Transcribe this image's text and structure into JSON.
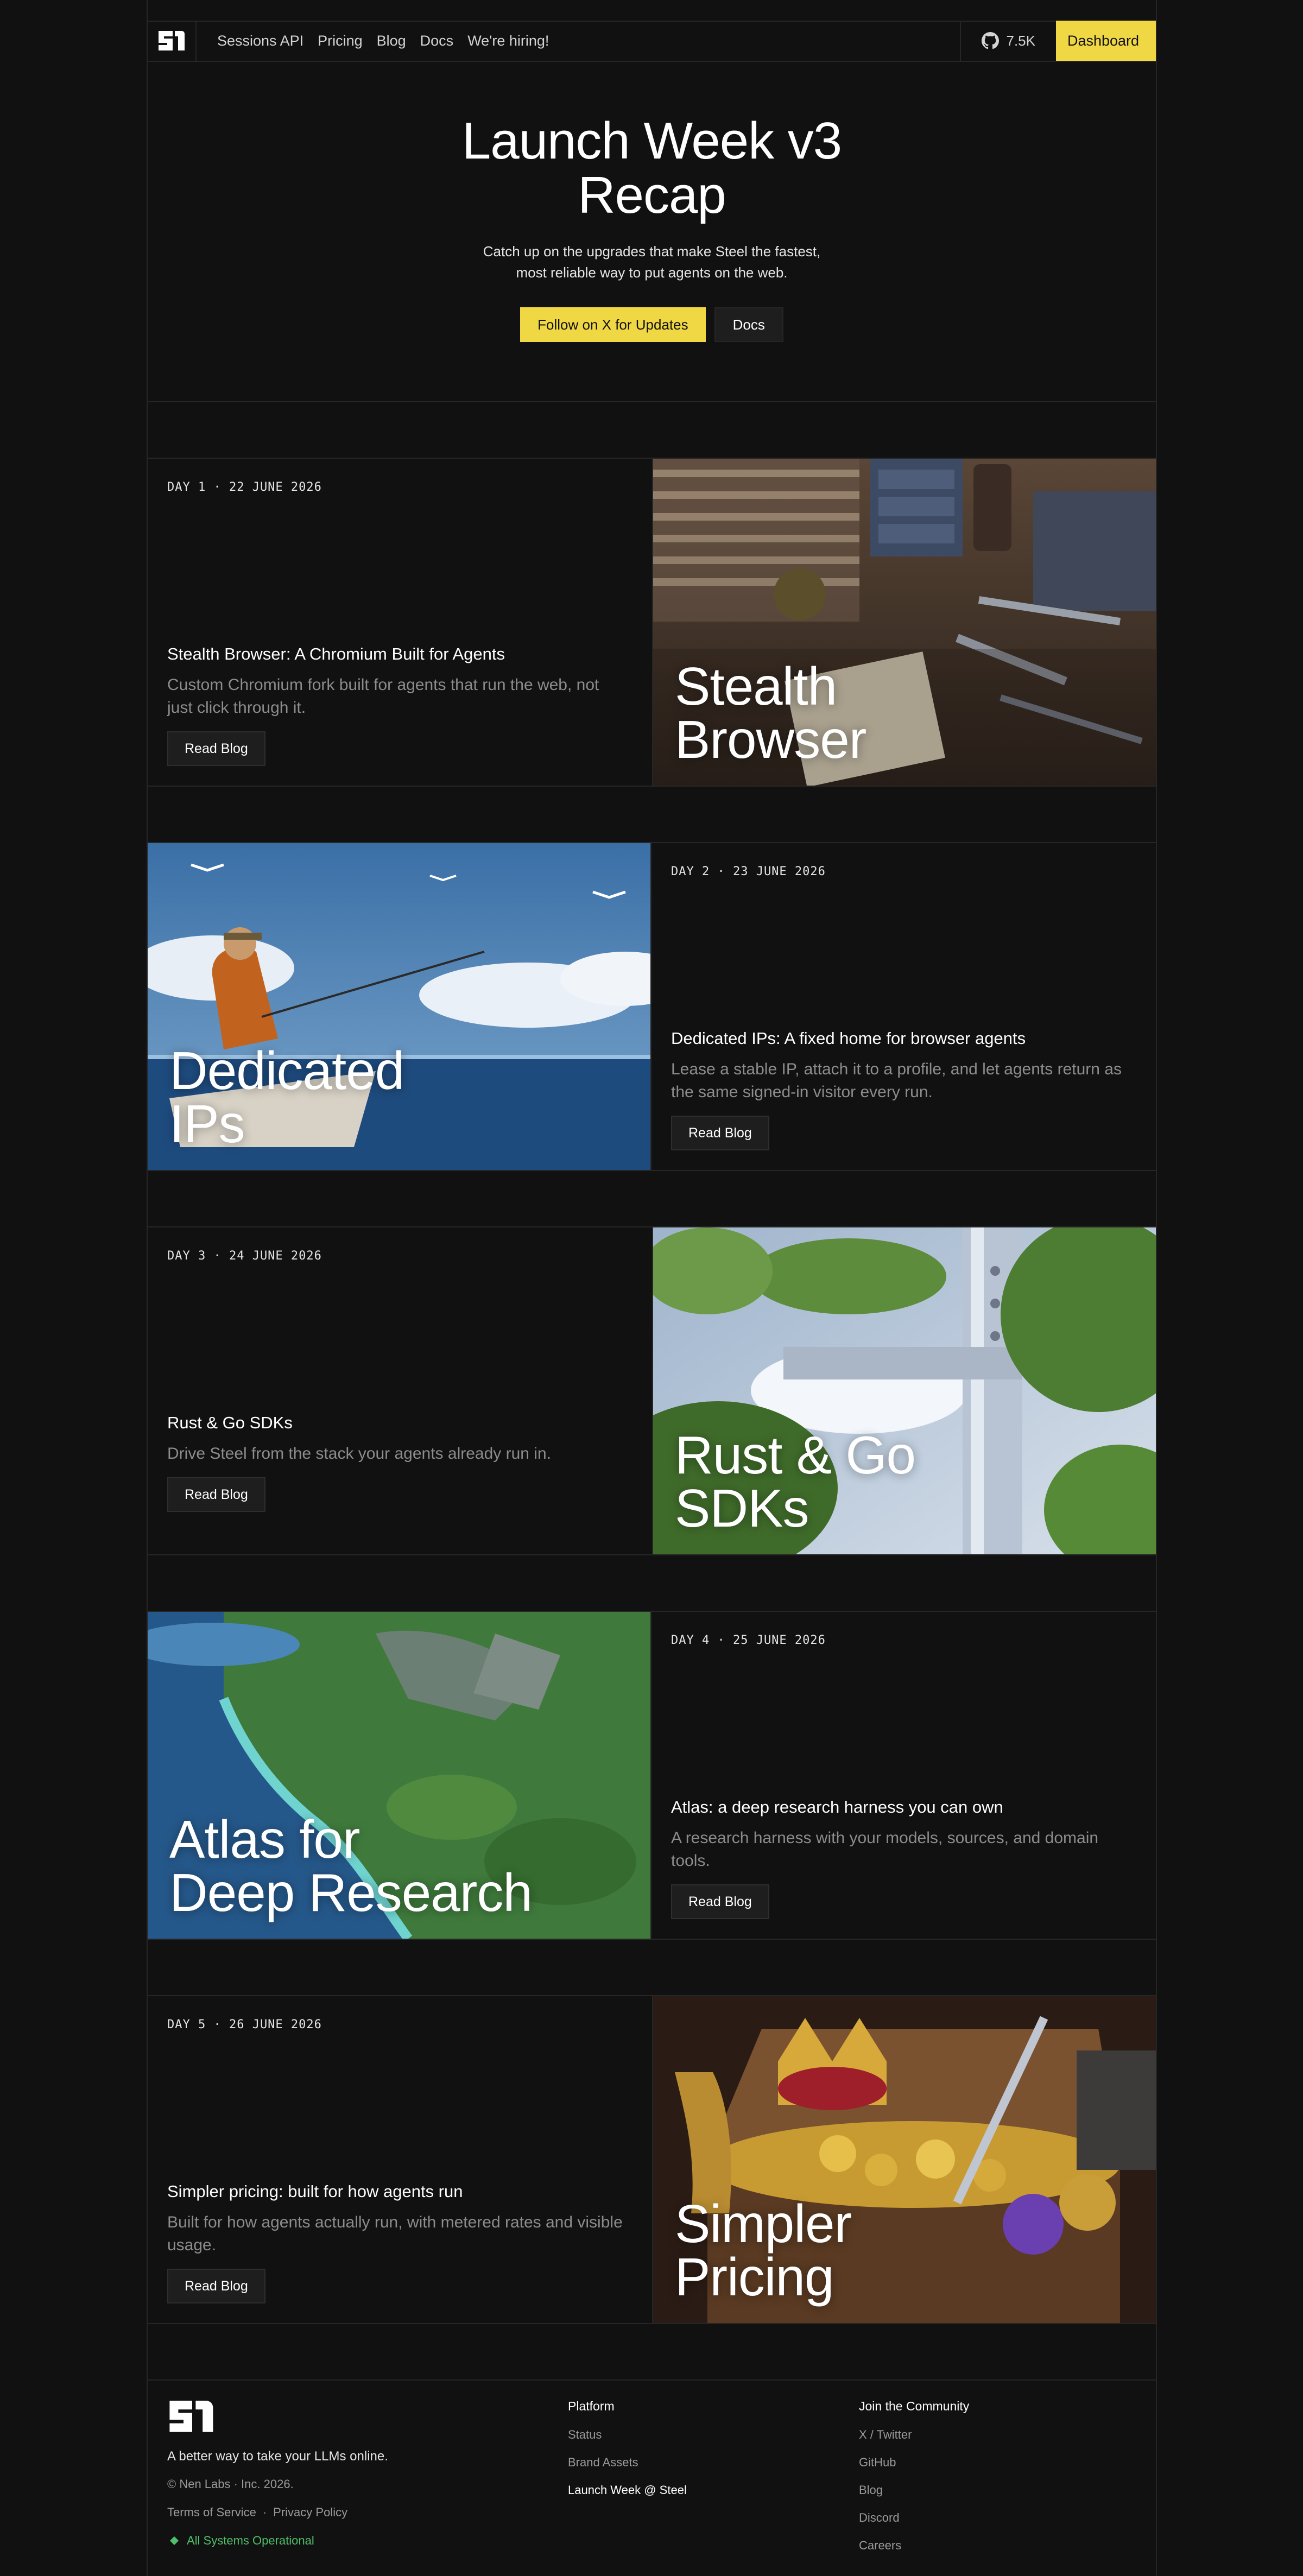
{
  "nav": {
    "links": [
      "Sessions API",
      "Pricing",
      "Blog",
      "Docs",
      "We're hiring!"
    ],
    "github_stars": "7.5K",
    "dashboard_label": "Dashboard"
  },
  "hero": {
    "title_line1": "Launch Week v3",
    "title_line2": "Recap",
    "subtitle": "Catch up on the upgrades that make Steel the fastest, most reliable way to put agents on the web.",
    "follow_label": "Follow on X for Updates",
    "docs_label": "Docs"
  },
  "sections": [
    {
      "day": "DAY 1 · 22 JUNE 2026",
      "title": "Stealth Browser: A Chromium Built for Agents",
      "desc": "Custom Chromium fork built for agents that run the web, not just click through it.",
      "image_title_line1": "Stealth",
      "image_title_line2": "Browser",
      "read_label": "Read Blog"
    },
    {
      "day": "DAY 2 · 23 JUNE 2026",
      "title": "Dedicated IPs: A fixed home for browser agents",
      "desc": "Lease a stable IP, attach it to a profile, and let agents return as the same signed-in visitor every run.",
      "image_title_line1": "Dedicated",
      "image_title_line2": "IPs",
      "read_label": "Read Blog"
    },
    {
      "day": "DAY 3 · 24 JUNE 2026",
      "title": "Rust & Go SDKs",
      "desc": "Drive Steel from the stack your agents already run in.",
      "image_title_line1": "Rust & Go",
      "image_title_line2": "SDKs",
      "read_label": "Read Blog"
    },
    {
      "day": "DAY 4 · 25 JUNE 2026",
      "title": "Atlas: a deep research harness you can own",
      "desc": "A research harness with your models, sources, and domain tools.",
      "image_title_line1": "Atlas for",
      "image_title_line2": "Deep Research",
      "read_label": "Read Blog"
    },
    {
      "day": "DAY 5 · 26 JUNE 2026",
      "title": "Simpler pricing: built for how agents run",
      "desc": "Built for how agents actually run, with metered rates and visible usage.",
      "image_title_line1": "Simpler",
      "image_title_line2": "Pricing",
      "read_label": "Read Blog"
    }
  ],
  "footer": {
    "tagline": "A better way to take your LLMs online.",
    "copyright": "© Nen Labs · Inc. 2026.",
    "terms": "Terms of Service",
    "separator": "·",
    "privacy": "Privacy Policy",
    "status": "All Systems Operational",
    "platform_heading": "Platform",
    "platform_items": [
      "Status",
      "Brand Assets",
      "Launch Week @ Steel"
    ],
    "community_heading": "Join the Community",
    "community_items": [
      "X / Twitter",
      "GitHub",
      "Blog",
      "Discord",
      "Careers"
    ]
  },
  "colors": {
    "background": "#111111",
    "accent": "#f0d845",
    "status_green": "#4fbf6a"
  }
}
